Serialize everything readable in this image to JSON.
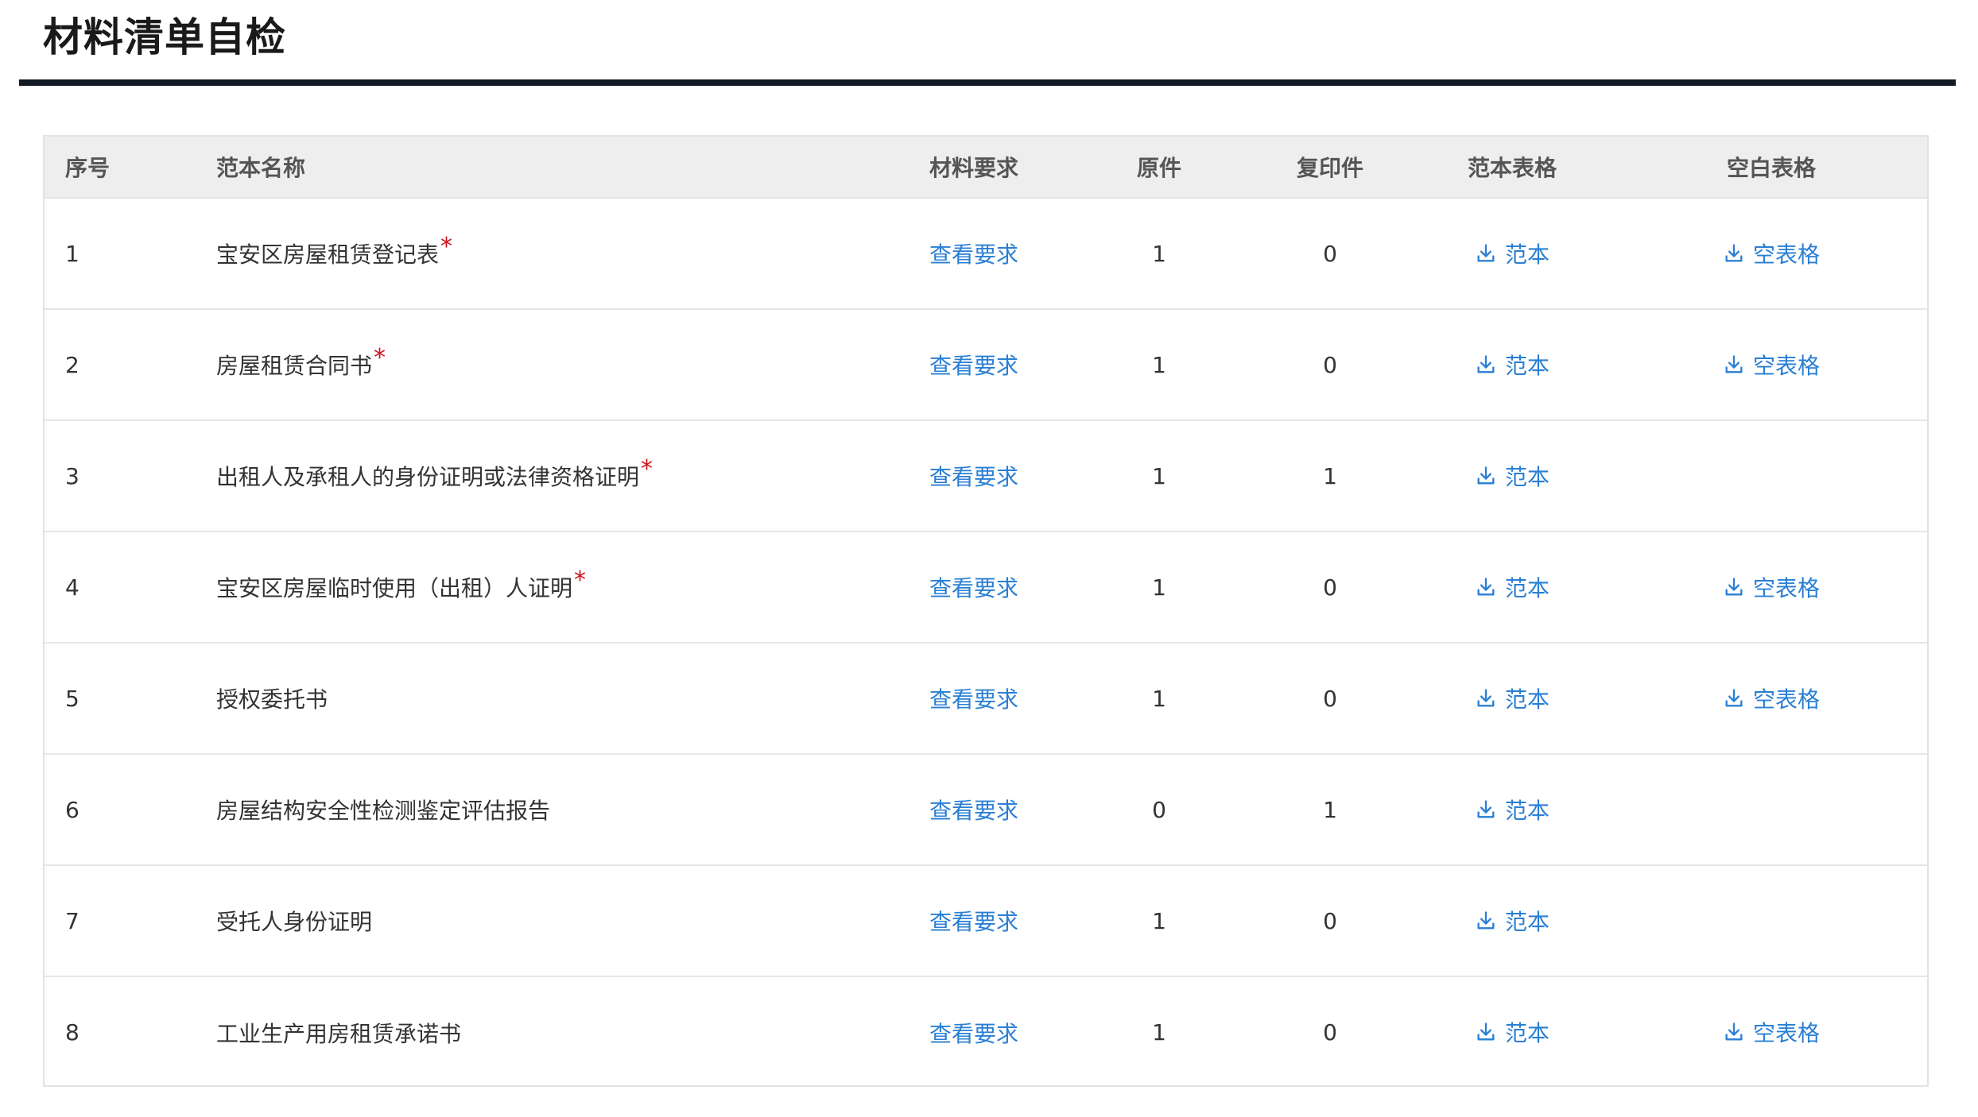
{
  "page": {
    "title": "材料清单自检"
  },
  "colors": {
    "link": "#2a7fd4",
    "required": "#d0101b",
    "header_rule": "#141a24",
    "table_header_bg": "#eeeeee"
  },
  "icons": {
    "download": "download-icon"
  },
  "table": {
    "headers": [
      "序号",
      "范本名称",
      "材料要求",
      "原件",
      "复印件",
      "范本表格",
      "空白表格"
    ],
    "rows": [
      {
        "index": "1",
        "name": "宝安区房屋租赁登记表",
        "required": "*",
        "requirement_link": "查看要求",
        "original": "1",
        "copy": "0",
        "sample_link": "范本",
        "blank_link": "空表格"
      },
      {
        "index": "2",
        "name": "房屋租赁合同书",
        "required": "*",
        "requirement_link": "查看要求",
        "original": "1",
        "copy": "0",
        "sample_link": "范本",
        "blank_link": "空表格"
      },
      {
        "index": "3",
        "name": "出租人及承租人的身份证明或法律资格证明",
        "required": "*",
        "requirement_link": "查看要求",
        "original": "1",
        "copy": "1",
        "sample_link": "范本",
        "blank_link": ""
      },
      {
        "index": "4",
        "name": "宝安区房屋临时使用（出租）人证明",
        "required": "*",
        "requirement_link": "查看要求",
        "original": "1",
        "copy": "0",
        "sample_link": "范本",
        "blank_link": "空表格"
      },
      {
        "index": "5",
        "name": "授权委托书",
        "required": "",
        "requirement_link": "查看要求",
        "original": "1",
        "copy": "0",
        "sample_link": "范本",
        "blank_link": "空表格"
      },
      {
        "index": "6",
        "name": "房屋结构安全性检测鉴定评估报告",
        "required": "",
        "requirement_link": "查看要求",
        "original": "0",
        "copy": "1",
        "sample_link": "范本",
        "blank_link": ""
      },
      {
        "index": "7",
        "name": "受托人身份证明",
        "required": "",
        "requirement_link": "查看要求",
        "original": "1",
        "copy": "0",
        "sample_link": "范本",
        "blank_link": ""
      },
      {
        "index": "8",
        "name": "工业生产用房租赁承诺书",
        "required": "",
        "requirement_link": "查看要求",
        "original": "1",
        "copy": "0",
        "sample_link": "范本",
        "blank_link": "空表格"
      }
    ]
  }
}
